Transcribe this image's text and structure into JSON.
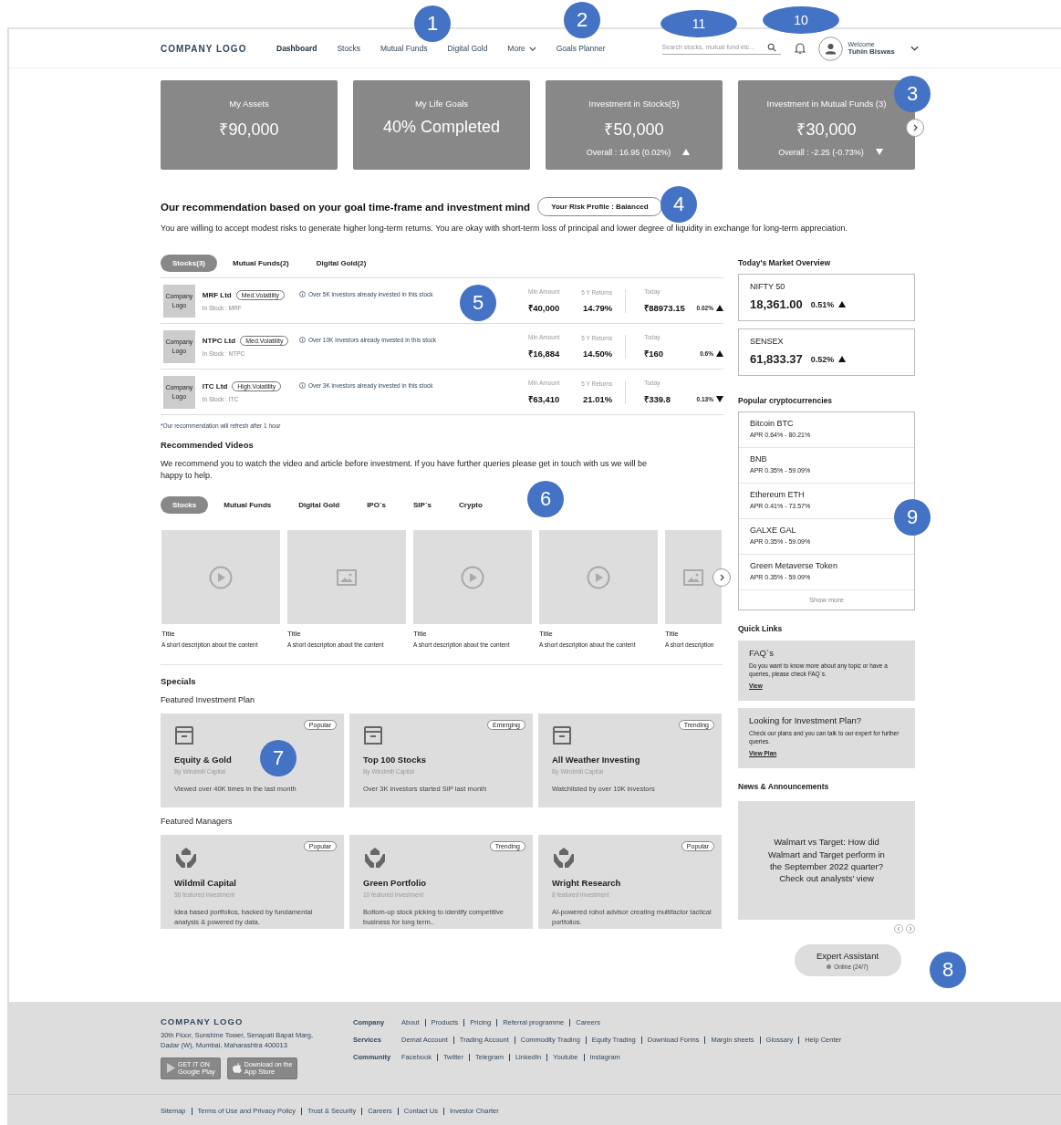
{
  "header": {
    "logo": "COMPANY LOGO",
    "nav": [
      {
        "label": "Dashboard",
        "selected": true,
        "dropdown": false
      },
      {
        "label": "Stocks",
        "selected": false,
        "dropdown": false
      },
      {
        "label": "Mutual Funds",
        "selected": false,
        "dropdown": false
      },
      {
        "label": "Digital Gold",
        "selected": false,
        "dropdown": false
      },
      {
        "label": "More",
        "selected": false,
        "dropdown": true
      },
      {
        "label": "Goals Planner",
        "selected": false,
        "dropdown": false
      }
    ],
    "search": {
      "placeholder": "Search stocks, mutual fund etc..."
    },
    "user": {
      "greeting": "Welcome",
      "name": "Tuhin Biswas"
    }
  },
  "summary_cards": [
    {
      "title": "My Assets",
      "value": "₹90,000"
    },
    {
      "title": "My Life Goals",
      "value": "40% Completed"
    },
    {
      "title": "Investment in Stocks(5)",
      "value": "₹50,000",
      "overall": "Overall : 16.95 (0.02%)",
      "up": true
    },
    {
      "title": "Investment in Mutual Funds (3)",
      "value": "₹30,000",
      "overall": "Overall : -2.25 (-0.73%)",
      "up": false
    }
  ],
  "recommendation": {
    "heading": "Our recommendation based on your goal time-frame and investment mind",
    "risk_profile": "Your Risk Profile : Balanced",
    "description": "You are willing to accept modest risks to generate higher long-term returns. You are okay with short-term loss of principal and lower degree of liquidity in exchange for long-term appreciation."
  },
  "stock_tabs": [
    {
      "label": "Stocks(3)",
      "selected": true
    },
    {
      "label": "Mutual Funds(2)",
      "selected": false
    },
    {
      "label": "Digital Gold(2)",
      "selected": false
    }
  ],
  "stocks": [
    {
      "logo": "Company Logo",
      "name": "MRF Ltd",
      "volatility": "Med.Volatility",
      "symbol": "In Stock : MRF",
      "note": "Over 5K investors already invested in this stock",
      "min_label": "Min Amount",
      "min": "₹40,000",
      "returns_label": "5 Y Returns",
      "returns": "14.79%",
      "today_label": "Today",
      "today": "₹88973.15",
      "change": "0.02%",
      "up": true
    },
    {
      "logo": "Company Logo",
      "name": "NTPC Ltd",
      "volatility": "Med.Volatility",
      "symbol": "In Stock : NTPC",
      "note": "Over 10K investors already invested in this stock",
      "min_label": "Min Amount",
      "min": "₹16,884",
      "returns_label": "5 Y Returns",
      "returns": "14.50%",
      "today_label": "Today",
      "today": "₹160",
      "change": "0.6%",
      "up": true
    },
    {
      "logo": "Company Logo",
      "name": "ITC Ltd",
      "volatility": "High.Volatility",
      "symbol": "In Stock : ITC",
      "note": "Over 3K investors already invested in this stock",
      "min_label": "Min Amount",
      "min": "₹63,410",
      "returns_label": "5 Y Returns",
      "returns": "21.01%",
      "today_label": "Today",
      "today": "₹339.8",
      "change": "0.13%",
      "up": false
    }
  ],
  "stocks_footnote": "*Our recommendation will refresh after 1 hour",
  "videos": {
    "heading": "Recommended Videos",
    "description": "We recommend you to watch the video and article before investment. If you have further queries please get in touch with us we will be happy to help.",
    "tabs": [
      {
        "label": "Stocks",
        "selected": true
      },
      {
        "label": "Mutual Funds",
        "selected": false
      },
      {
        "label": "Digital Gold",
        "selected": false
      },
      {
        "label": "IPO`s",
        "selected": false
      },
      {
        "label": "SIP`s",
        "selected": false
      },
      {
        "label": "Crypto",
        "selected": false
      }
    ],
    "items": [
      {
        "kind": "video",
        "title": "Title",
        "description": "A short description about the content"
      },
      {
        "kind": "image",
        "title": "Title",
        "description": "A short description about the content"
      },
      {
        "kind": "video",
        "title": "Title",
        "description": "A short description about the content"
      },
      {
        "kind": "video",
        "title": "Title",
        "description": "A short description about the content"
      },
      {
        "kind": "image",
        "title": "Title",
        "description": "A short description"
      }
    ]
  },
  "specials": {
    "heading": "Specials",
    "plans_heading": "Featured Investment Plan",
    "plans": [
      {
        "tag": "Popular",
        "title": "Equity & Gold",
        "by": "By Windmill Capital",
        "note": "Viewed over 40K times in the last month"
      },
      {
        "tag": "Emerging",
        "title": "Top 100 Stocks",
        "by": "By Windmill Capital",
        "note": "Over 3K investors started SIP last month"
      },
      {
        "tag": "Trending",
        "title": "All Weather Investing",
        "by": "By Windmill Capital",
        "note": "Watchlisted by over 10K investors"
      }
    ],
    "managers_heading": "Featured Managers",
    "managers": [
      {
        "tag": "Popular",
        "title": "Wildmil Capital",
        "by": "56 featured investment",
        "note": "Idea based portfolios, backed by fundamental analysis & powered by data."
      },
      {
        "tag": "Trending",
        "title": "Green Portfolio",
        "by": "10 featured investment",
        "note": "Bottom-up stock picking to identify competitive business for long term.."
      },
      {
        "tag": "Popular",
        "title": "Wright Research",
        "by": "8 featured investment",
        "note": "AI-powered robot advisor creating multifactor tactical portfolios."
      }
    ]
  },
  "market": {
    "heading": "Today's Market Overview",
    "indices": [
      {
        "name": "NIFTY 50",
        "value": "18,361.00",
        "change": "0.51%",
        "up": true
      },
      {
        "name": "SENSEX",
        "value": "61,833.37",
        "change": "0.52%",
        "up": true
      }
    ]
  },
  "crypto": {
    "heading": "Popular cryptocurrencies",
    "items": [
      {
        "name": "Bitcoin BTC",
        "apr": "APR 0.64% - 80.21%"
      },
      {
        "name": "BNB",
        "apr": "APR 0.35% - 59.09%"
      },
      {
        "name": "Ethereum ETH",
        "apr": "APR 0.41% - 73.57%"
      },
      {
        "name": "GALXE GAL",
        "apr": "APR 0.35% - 59.09%"
      },
      {
        "name": "Green Metaverse Token",
        "apr": "APR 0.35% - 59.09%"
      }
    ],
    "show_more": "Show more"
  },
  "quick_links": {
    "heading": "Quick Links",
    "items": [
      {
        "title": "FAQ`s",
        "text": "Do you want to know more about any topic or have a queries, please check FAQ`s.",
        "link": "View"
      },
      {
        "title": "Looking for Investment Plan?",
        "text": "Check our plans and you can talk to our expert for further queries.",
        "link": "View Plan"
      }
    ]
  },
  "news": {
    "heading": "News & Announcements",
    "headline": "Walmart vs Target: How did Walmart and Target perform in the September 2022 quarter? Check out analysts' view"
  },
  "assistant": {
    "title": "Expert Assistant",
    "status": "Online (24/7)"
  },
  "footer": {
    "logo": "COMPANY LOGO",
    "address": "30th Floor, Sunshine Tower, Senapati Bapat Marg, Dadar (W), Mumbai, Maharashtra 400013",
    "stores": [
      {
        "kind": "google",
        "small": "GET IT ON",
        "name": "Google Play"
      },
      {
        "kind": "apple",
        "small": "Download on the",
        "name": "App Store"
      }
    ],
    "groups": [
      {
        "label": "Company",
        "links": [
          "About",
          "Products",
          "Pricing",
          "Referral programme",
          "Careers"
        ]
      },
      {
        "label": "Services",
        "links": [
          "Demat Account",
          "Trading Account",
          "Commodity Trading",
          "Equity Trading",
          "Download Forms",
          "Margin sheets",
          "Glossary",
          "Help Center"
        ]
      },
      {
        "label": "Community",
        "links": [
          "Facebook",
          "Twitter",
          "Telegram",
          "LinkedIn",
          "Youtube",
          "Instagram"
        ]
      }
    ],
    "bottom_links": [
      "Sitemap",
      "Terms of Use and Privacy Policy",
      "Trust & Security",
      "Careers",
      "Contact Us",
      "Investor Charter"
    ]
  },
  "annotations": [
    {
      "number": "1",
      "kind": "circle"
    },
    {
      "number": "2",
      "kind": "circle"
    },
    {
      "number": "11",
      "kind": "ellipse"
    },
    {
      "number": "10",
      "kind": "ellipse"
    },
    {
      "number": "3",
      "kind": "circle"
    },
    {
      "number": "4",
      "kind": "circle"
    },
    {
      "number": "5",
      "kind": "circle"
    },
    {
      "number": "6",
      "kind": "circle"
    },
    {
      "number": "7",
      "kind": "circle"
    },
    {
      "number": "8",
      "kind": "circle"
    },
    {
      "number": "9",
      "kind": "circle"
    }
  ]
}
